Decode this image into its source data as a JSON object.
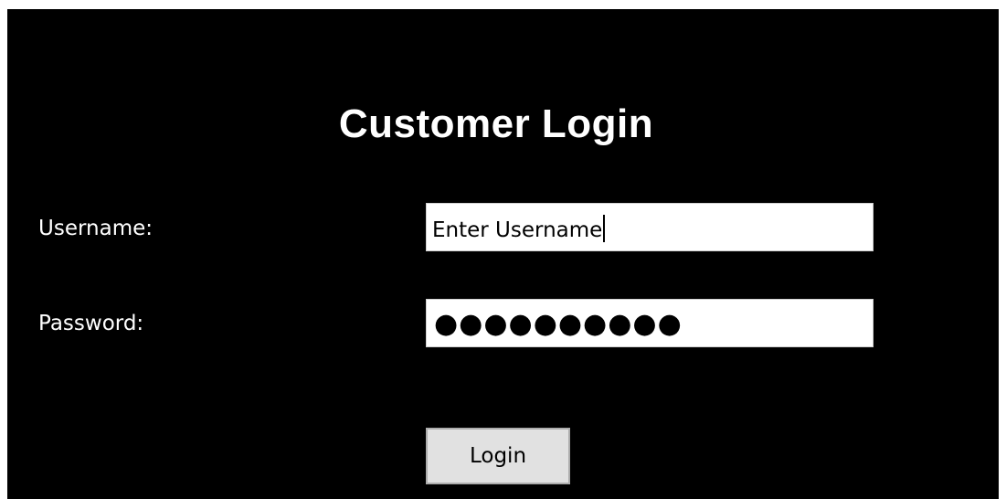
{
  "form": {
    "title": "Customer Login",
    "username": {
      "label": "Username:",
      "value": "Enter Username"
    },
    "password": {
      "label": "Password:",
      "masked_value": "●●●●●●●●●●"
    },
    "login_button": {
      "label": "Login"
    }
  },
  "colors": {
    "background": "#000000",
    "text": "#ffffff",
    "field_background": "#ffffff",
    "button_background": "#e1e1e1",
    "button_border": "#adadad"
  }
}
